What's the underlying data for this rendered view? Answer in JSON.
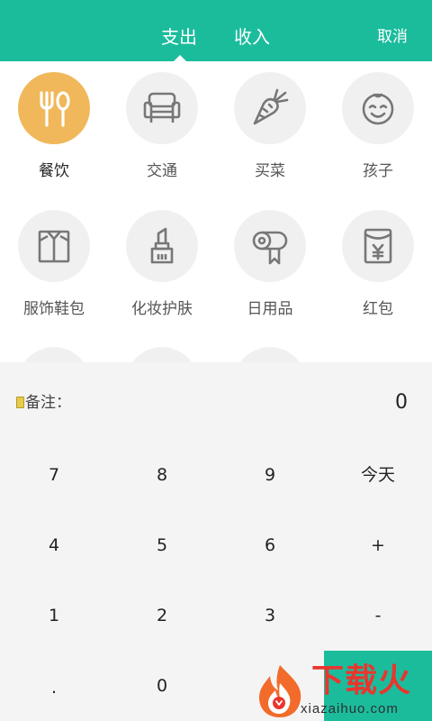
{
  "header": {
    "tabs": [
      {
        "label": "支出",
        "active": true
      },
      {
        "label": "收入",
        "active": false
      }
    ],
    "cancel_label": "取消"
  },
  "categories": [
    {
      "label": "餐饮",
      "icon": "utensils-icon",
      "selected": true
    },
    {
      "label": "交通",
      "icon": "seat-icon",
      "selected": false
    },
    {
      "label": "买菜",
      "icon": "carrot-icon",
      "selected": false
    },
    {
      "label": "孩子",
      "icon": "baby-face-icon",
      "selected": false
    },
    {
      "label": "服饰鞋包",
      "icon": "shirt-icon",
      "selected": false
    },
    {
      "label": "化妆护肤",
      "icon": "lipstick-icon",
      "selected": false
    },
    {
      "label": "日用品",
      "icon": "tissue-roll-icon",
      "selected": false
    },
    {
      "label": "红包",
      "icon": "red-envelope-icon",
      "selected": false
    }
  ],
  "keypad": {
    "note_label": "备注：",
    "amount": "0",
    "keys": {
      "k7": "7",
      "k8": "8",
      "k9": "9",
      "today": "今天",
      "k4": "4",
      "k5": "5",
      "k6": "6",
      "plus": "+",
      "k1": "1",
      "k2": "2",
      "k3": "3",
      "minus": "-",
      "dot": ".",
      "k0": "0"
    }
  },
  "watermark": {
    "title": "下载火",
    "subtitle": "xiazaihuo.com"
  },
  "colors": {
    "accent": "#1bbc9c",
    "selected_icon_bg": "#f0b85a",
    "icon_bg": "#f0f0f0",
    "icon_stroke": "#777777",
    "keypad_bg": "#f4f4f4",
    "watermark_red": "#e8362e"
  }
}
